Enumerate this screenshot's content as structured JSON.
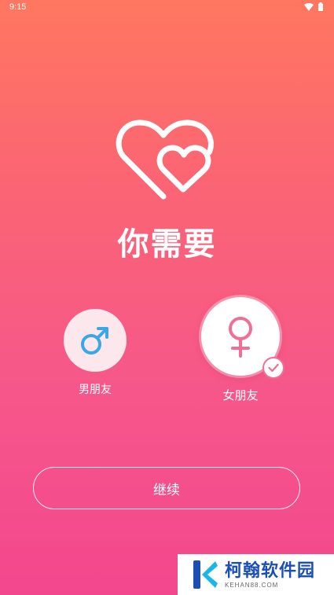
{
  "status_bar": {
    "time": "9:15",
    "icons": [
      "wifi-icon",
      "battery-icon"
    ]
  },
  "app": {
    "title": "你需要",
    "logo_icon": "double-heart-icon"
  },
  "options": [
    {
      "label": "男朋友",
      "icon": "male-symbol-icon",
      "color": "#3aa7e6",
      "selected": false
    },
    {
      "label": "女朋友",
      "icon": "female-symbol-icon",
      "color": "#ef6f95",
      "selected": true
    }
  ],
  "continue_button": {
    "label": "继续"
  },
  "watermark": {
    "name": "柯翰软件园",
    "domain": "KEHAN88.COM"
  },
  "colors": {
    "background_top": "#ff7760",
    "background_bottom": "#f3478d",
    "male_accent": "#3aa7e6",
    "female_accent": "#ef6f95"
  }
}
